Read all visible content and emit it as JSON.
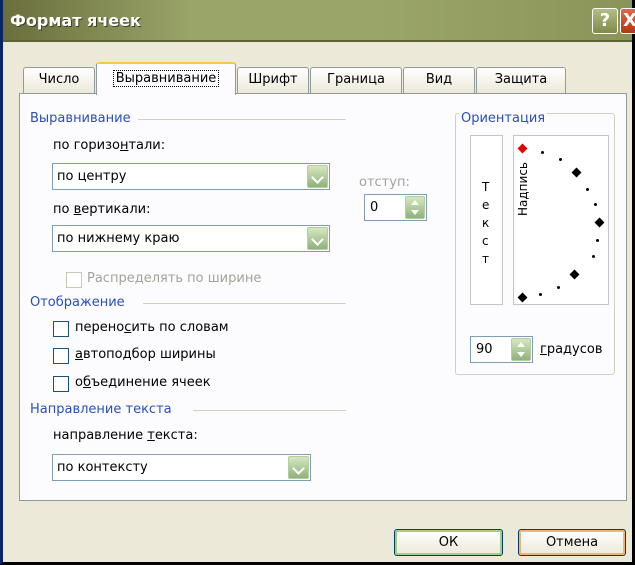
{
  "window": {
    "title": "Формат ячеек",
    "help_glyph": "?",
    "close_glyph": "X"
  },
  "tabs": [
    {
      "label": "Число"
    },
    {
      "label": "Выравнивание",
      "active": true
    },
    {
      "label": "Шрифт"
    },
    {
      "label": "Граница"
    },
    {
      "label": "Вид"
    },
    {
      "label": "Защита"
    }
  ],
  "alignment": {
    "group_title": "Выравнивание",
    "horizontal_label_pre": "по горизо",
    "horizontal_label_u": "н",
    "horizontal_label_post": "тали:",
    "horizontal_value": "по центру",
    "indent_label": "отступ:",
    "indent_value": "0",
    "vertical_label_pre": "по ",
    "vertical_label_u": "в",
    "vertical_label_post": "ертикали:",
    "vertical_value": "по нижнему краю",
    "distribute_label": "Распределять по ширине"
  },
  "orientation": {
    "group_title": "Ориентация",
    "vertical_text": [
      "Т",
      "е",
      "к",
      "с",
      "т"
    ],
    "dial_label": "Надпись",
    "degrees_value": "90",
    "degrees_label_u": "г",
    "degrees_label_post": "радусов"
  },
  "display": {
    "group_title": "Отображение",
    "wrap_pre": "перено",
    "wrap_u": "с",
    "wrap_post": "ить по словам",
    "wrap_checked": false,
    "shrink_u": "а",
    "shrink_post": "втоподбор ширины",
    "shrink_checked": false,
    "merge_pre": "о",
    "merge_u": "б",
    "merge_post": "ъединение ячеек",
    "merge_checked": false
  },
  "direction": {
    "group_title": "Направление текста",
    "label_pre": "направление ",
    "label_u": "т",
    "label_post": "екста:",
    "value": "по контексту"
  },
  "buttons": {
    "ok": "ОК",
    "cancel": "Отмена"
  },
  "colors": {
    "titlebar": "#9aa56a",
    "group_title": "#2a4fb8",
    "active_tab_highlight": "#ffc83c",
    "selected_marker": "#e00000"
  }
}
